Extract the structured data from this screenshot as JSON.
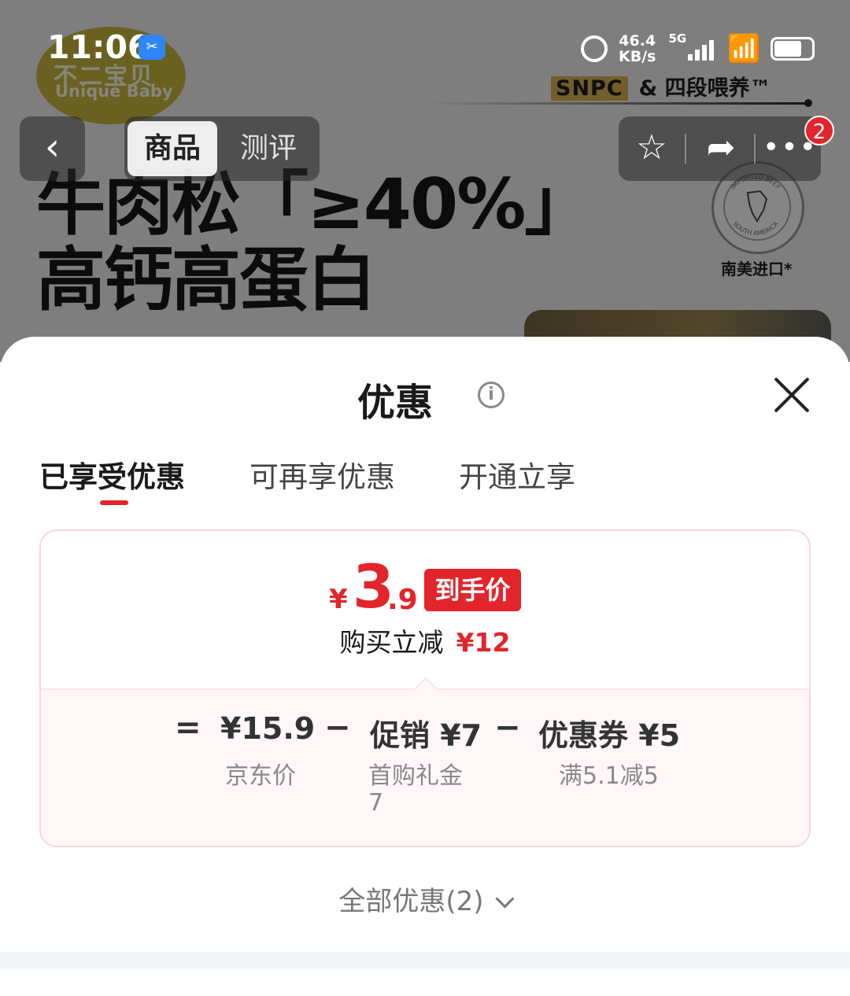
{
  "status_bar": {
    "time": "11:06",
    "network_speed_value": "46.4",
    "network_speed_unit": "KB/s",
    "signal_type": "5G"
  },
  "product_banner": {
    "brand_line1": "不二宝贝",
    "brand_line2": "Unique Baby",
    "headline_line1": "牛肉松「≥40%」",
    "headline_line2": "高钙高蛋白",
    "snpc_tag": "SNPC",
    "snpc_text": "& 四段喂养™",
    "seal_label": "南美进口*",
    "seal_text_top": "IMPORTED BEEF",
    "seal_text_bottom": "SOUTH AMERICA"
  },
  "top_nav": {
    "tabs": [
      {
        "label": "商品",
        "active": true
      },
      {
        "label": "测评",
        "active": false
      }
    ],
    "message_count": "2"
  },
  "sheet": {
    "title": "优惠",
    "tabs": [
      {
        "label": "已享受优惠",
        "active": true
      },
      {
        "label": "可再享优惠",
        "active": false
      },
      {
        "label": "开通立享",
        "active": false
      }
    ],
    "final_price": {
      "currency": "¥",
      "integer": "3",
      "decimal": ".9",
      "badge": "到手价"
    },
    "savings_label": "购买立减",
    "savings_amount": "¥12",
    "breakdown": {
      "equals": "=",
      "minus": "−",
      "items": [
        {
          "title": "¥15.9",
          "subtitle": "京东价"
        },
        {
          "title": "促销 ¥7",
          "subtitle": "首购礼金\n7"
        },
        {
          "title": "优惠券 ¥5",
          "subtitle": "满5.1减5"
        }
      ]
    },
    "all_offers_label": "全部优惠(2)"
  },
  "colors": {
    "accent_red": "#e3242b",
    "card_border": "#fbd6dd",
    "card_lower_bg": "#fff6f7"
  }
}
